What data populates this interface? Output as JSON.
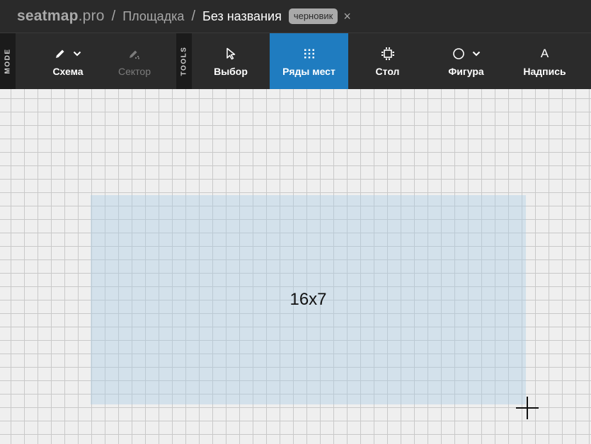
{
  "header": {
    "brand_main": "seatmap",
    "brand_suffix": ".pro",
    "separator": "/",
    "venue": "Площадка",
    "title": "Без названия",
    "badge": "черновик",
    "close_glyph": "×"
  },
  "toolbar": {
    "mode_tag": "MODE",
    "tools_tag": "TOOLS",
    "mode_items": [
      {
        "label": "Схема",
        "icon": "pencil-icon",
        "has_dropdown": true,
        "state": "enabled"
      },
      {
        "label": "Сектор",
        "icon": "sector-pencil-icon",
        "has_dropdown": false,
        "state": "disabled"
      }
    ],
    "tool_items": [
      {
        "label": "Выбор",
        "icon": "cursor-icon",
        "state": "enabled"
      },
      {
        "label": "Ряды мест",
        "icon": "seat-grid-icon",
        "state": "active"
      },
      {
        "label": "Стол",
        "icon": "table-icon",
        "state": "enabled"
      },
      {
        "label": "Фигура",
        "icon": "circle-icon",
        "has_dropdown": true,
        "state": "enabled"
      },
      {
        "label": "Надпись",
        "icon": "text-icon",
        "glyph": "A",
        "state": "enabled"
      }
    ]
  },
  "canvas": {
    "selection_label": "16x7",
    "cursor": "crosshair-icon"
  },
  "colors": {
    "header_bg": "#2a2a2a",
    "active_tool": "#1f7cc0",
    "canvas_bg": "#efefef",
    "grid_line": "#c9c9c9",
    "selection_fill": "#aacde6"
  }
}
